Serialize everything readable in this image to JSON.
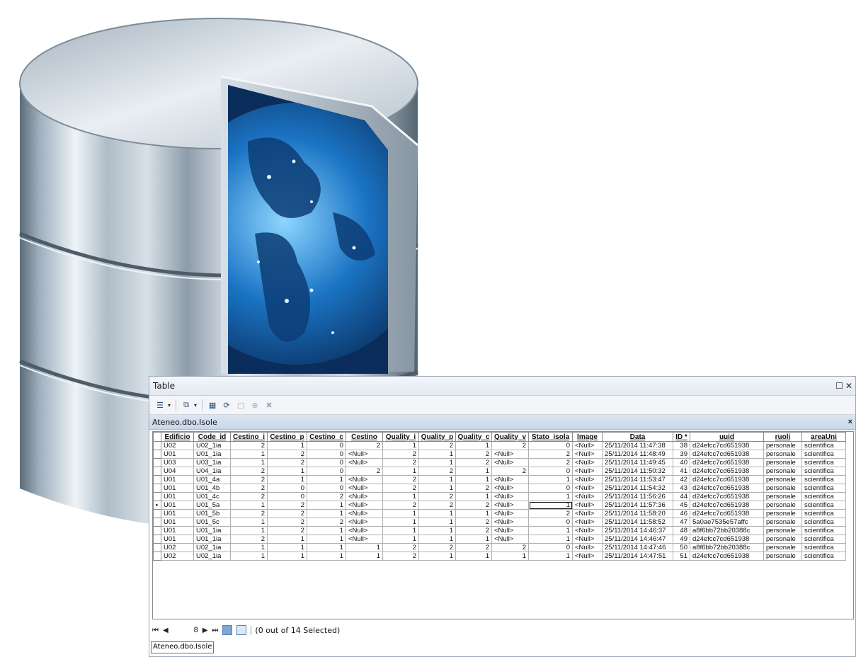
{
  "colors": {
    "window_border": "#9aa6b5",
    "tab_header": "#c8d7ea",
    "cylinder_metal": "#c9d3dc",
    "globe_blue": "#1b74c4"
  },
  "window": {
    "title": "Table",
    "toolbar_icons": [
      "table-options-icon",
      "related-tables-icon",
      "select-by-attributes-icon",
      "switch-selection-icon",
      "clear-selection-icon",
      "zoom-to-selected-icon",
      "delete-selected-icon"
    ]
  },
  "table_tab": {
    "name": "Ateneo.dbo.Isole"
  },
  "grid": {
    "columns": [
      "Edificio",
      "Code_id",
      "Cestino_i",
      "Cestino_p",
      "Cestino_c",
      "Cestino",
      "Quality_i",
      "Quality_p",
      "Quality_c",
      "Quality_v",
      "Stato_isola",
      "Image",
      "Data",
      "ID *",
      "uuid",
      "ruoli",
      "areaUni"
    ],
    "rows": [
      [
        "U02",
        "U02_1ia",
        "2",
        "1",
        "0",
        "2",
        "1",
        "2",
        "1",
        "2",
        "0",
        "<Null>",
        "25/11/2014 11:47:38",
        "38",
        "d24efcc7cd651938",
        "personale",
        "scientifica"
      ],
      [
        "U01",
        "U01_1ia",
        "1",
        "2",
        "0",
        "<Null>",
        "2",
        "1",
        "2",
        "<Null>",
        "2",
        "<Null>",
        "25/11/2014 11:48:49",
        "39",
        "d24efcc7cd651938",
        "personale",
        "scientifica"
      ],
      [
        "U03",
        "U03_1ia",
        "1",
        "2",
        "0",
        "<Null>",
        "2",
        "1",
        "2",
        "<Null>",
        "2",
        "<Null>",
        "25/11/2014 11:49:45",
        "40",
        "d24efcc7cd651938",
        "personale",
        "scientifica"
      ],
      [
        "U04",
        "U04_1ia",
        "2",
        "1",
        "0",
        "2",
        "1",
        "2",
        "1",
        "2",
        "0",
        "<Null>",
        "25/11/2014 11:50:32",
        "41",
        "d24efcc7cd651938",
        "personale",
        "scientifica"
      ],
      [
        "U01",
        "U01_4a",
        "2",
        "1",
        "1",
        "<Null>",
        "2",
        "1",
        "1",
        "<Null>",
        "1",
        "<Null>",
        "25/11/2014 11:53:47",
        "42",
        "d24efcc7cd651938",
        "personale",
        "scientifica"
      ],
      [
        "U01",
        "U01_4b",
        "2",
        "0",
        "0",
        "<Null>",
        "2",
        "1",
        "2",
        "<Null>",
        "0",
        "<Null>",
        "25/11/2014 11:54:32",
        "43",
        "d24efcc7cd651938",
        "personale",
        "scientifica"
      ],
      [
        "U01",
        "U01_4c",
        "2",
        "0",
        "2",
        "<Null>",
        "1",
        "2",
        "1",
        "<Null>",
        "1",
        "<Null>",
        "25/11/2014 11:56:26",
        "44",
        "d24efcc7cd651938",
        "personale",
        "scientifica"
      ],
      [
        "U01",
        "U01_5a",
        "1",
        "2",
        "1",
        "<Null>",
        "2",
        "2",
        "2",
        "<Null>",
        "1",
        "<Null>",
        "25/11/2014 11:57:36",
        "45",
        "d24efcc7cd651938",
        "personale",
        "scientifica"
      ],
      [
        "U01",
        "U01_5b",
        "2",
        "2",
        "1",
        "<Null>",
        "1",
        "1",
        "1",
        "<Null>",
        "2",
        "<Null>",
        "25/11/2014 11:58:20",
        "46",
        "d24efcc7cd651938",
        "personale",
        "scientifica"
      ],
      [
        "U01",
        "U01_5c",
        "1",
        "2",
        "2",
        "<Null>",
        "1",
        "1",
        "2",
        "<Null>",
        "0",
        "<Null>",
        "25/11/2014 11:58:52",
        "47",
        "5a0ae7535e57affc",
        "personale",
        "scientifica"
      ],
      [
        "U01",
        "U01_1ia",
        "1",
        "2",
        "1",
        "<Null>",
        "1",
        "1",
        "2",
        "<Null>",
        "1",
        "<Null>",
        "25/11/2014 14:46:37",
        "48",
        "a8f6bb72bb20388c",
        "personale",
        "scientifica"
      ],
      [
        "U01",
        "U01_1ia",
        "2",
        "1",
        "1",
        "<Null>",
        "1",
        "1",
        "1",
        "<Null>",
        "1",
        "<Null>",
        "25/11/2014 14:46:47",
        "49",
        "d24efcc7cd651938",
        "personale",
        "scientifica"
      ],
      [
        "U02",
        "U02_1ia",
        "1",
        "1",
        "1",
        "1",
        "2",
        "2",
        "2",
        "2",
        "0",
        "<Null>",
        "25/11/2014 14:47:46",
        "50",
        "a8f6bb72bb20388c",
        "personale",
        "scientifica"
      ],
      [
        "U02",
        "U02_1ia",
        "1",
        "1",
        "1",
        "1",
        "2",
        "1",
        "1",
        "1",
        "1",
        "<Null>",
        "25/11/2014 14:47:51",
        "51",
        "d24efcc7cd651938",
        "personale",
        "scientifica"
      ]
    ],
    "current_row_marker": "▸"
  },
  "navigation": {
    "first": "⏮",
    "prev": "◀",
    "current_record": "8",
    "next": "▶",
    "last": "⏭",
    "selection_status": "(0 out of 14 Selected)"
  }
}
